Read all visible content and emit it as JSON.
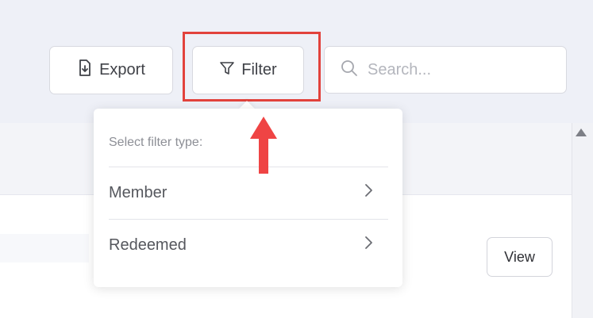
{
  "toolbar": {
    "export_label": "Export",
    "filter_label": "Filter",
    "search_placeholder": "Search..."
  },
  "filter_menu": {
    "heading": "Select filter type:",
    "items": [
      {
        "label": "Member"
      },
      {
        "label": "Redeemed"
      }
    ]
  },
  "table": {
    "view_label": "View"
  },
  "colors": {
    "highlight": "#e2423c",
    "annotation_arrow": "#ef4444",
    "page_background": "#eef0f7"
  },
  "icons": {
    "export": "export-download-icon",
    "filter": "funnel-icon",
    "search": "search-icon",
    "chevron": "chevron-right-icon"
  }
}
